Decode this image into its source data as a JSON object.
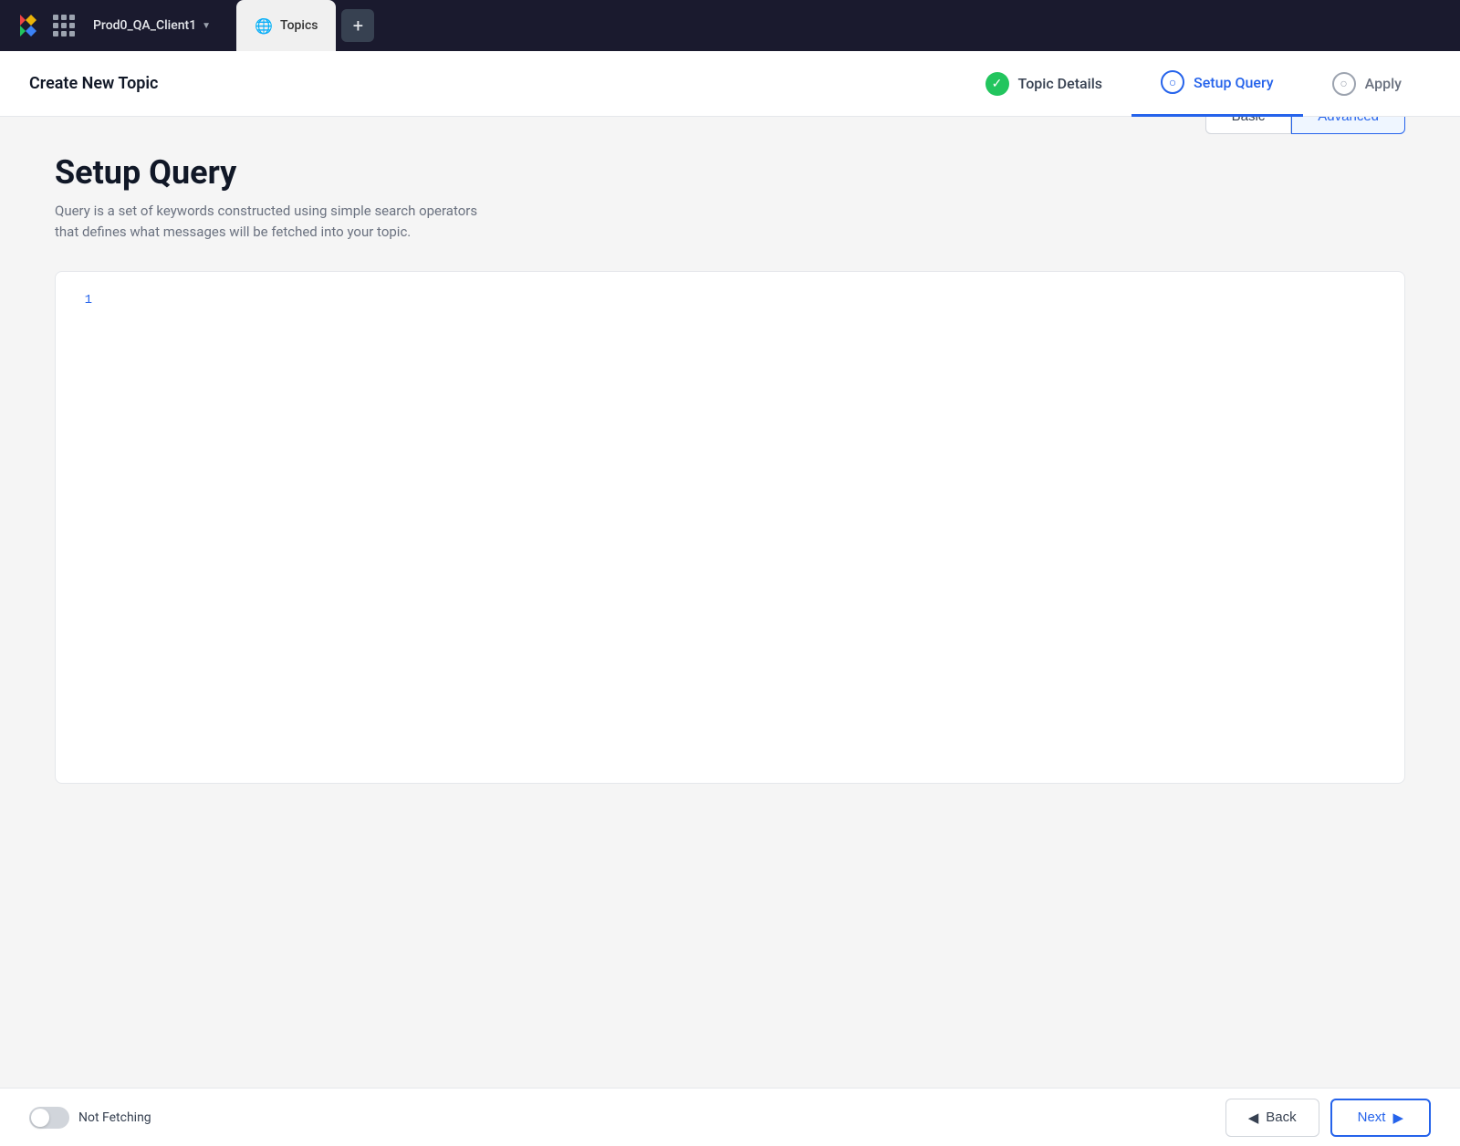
{
  "topbar": {
    "workspace_name": "Prod0_QA_Client1",
    "tab_label": "Topics",
    "tab_icon": "🌐",
    "add_tab_icon": "+"
  },
  "header": {
    "page_title": "Create New Topic",
    "steps": [
      {
        "label": "Topic Details",
        "state": "completed",
        "icon": "✓"
      },
      {
        "label": "Setup Query",
        "state": "active",
        "icon": "○"
      },
      {
        "label": "Apply",
        "state": "inactive",
        "icon": "○"
      }
    ]
  },
  "main": {
    "section_title": "Setup Query",
    "section_desc_line1": "Query is a set of keywords constructed using simple search operators",
    "section_desc_line2": "that defines what messages will be fetched into your topic.",
    "query_type_buttons": [
      {
        "label": "Basic",
        "active": false
      },
      {
        "label": "Advanced",
        "active": true
      }
    ],
    "editor": {
      "line_number": "1"
    }
  },
  "footer": {
    "toggle_label": "Not Fetching",
    "back_label": "Back",
    "next_label": "Next",
    "back_arrow": "◀",
    "next_arrow": "▶"
  }
}
